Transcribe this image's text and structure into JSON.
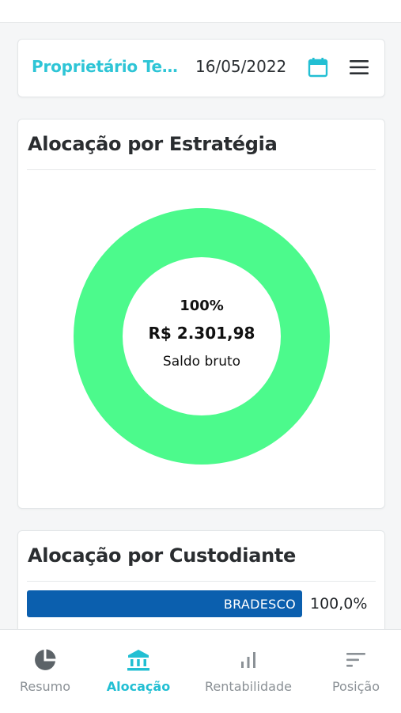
{
  "header": {
    "owner_name": "Proprietário Tes...",
    "date": "16/05/2022",
    "calendar_icon": "calendar-icon",
    "menu_icon": "hamburger-menu-icon"
  },
  "strategy_section": {
    "title": "Alocação por Estratégia",
    "center_percent": "100%",
    "center_amount": "R$ 2.301,98",
    "center_caption": "Saldo bruto",
    "segment_color": "#4cfa8c"
  },
  "custodian_section": {
    "title": "Alocação por Custodiante",
    "rows": [
      {
        "name": "BRADESCO",
        "value": "100,0%",
        "fraction": 1.0,
        "color": "#0b5fae"
      }
    ]
  },
  "bottom_nav": {
    "items": [
      {
        "label": "Resumo",
        "icon": "pie-chart-icon",
        "active": false
      },
      {
        "label": "Alocação",
        "icon": "bank-icon",
        "active": true
      },
      {
        "label": "Rentabilidade",
        "icon": "bar-chart-icon",
        "active": false
      },
      {
        "label": "Posição",
        "icon": "sort-lines-icon",
        "active": false
      }
    ]
  },
  "colors": {
    "accent": "#22bfd3",
    "donut": "#4cfa8c",
    "bar": "#0b5fae"
  }
}
